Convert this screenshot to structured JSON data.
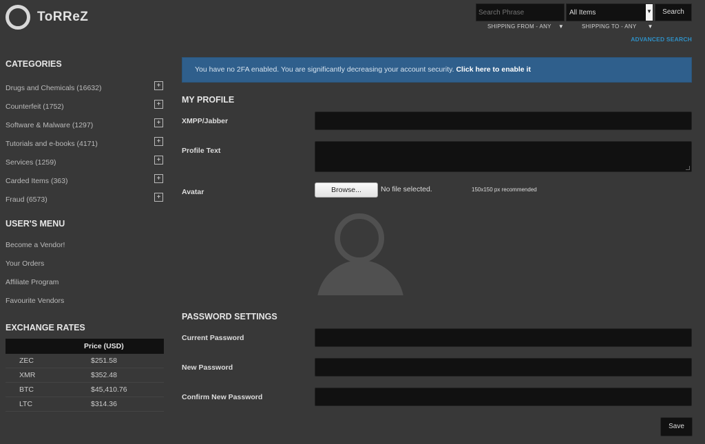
{
  "brand": {
    "name": "ToRReZ"
  },
  "search": {
    "placeholder": "Search Phrase",
    "category_selected": "All Items",
    "button_label": "Search",
    "shipping_from": "SHIPPING FROM - ANY",
    "shipping_to": "SHIPPING TO - ANY",
    "advanced_label": "ADVANCED SEARCH"
  },
  "sidebar": {
    "categories_heading": "CATEGORIES",
    "categories": [
      {
        "label": "Drugs and Chemicals (16632)"
      },
      {
        "label": "Counterfeit (1752)"
      },
      {
        "label": "Software & Malware (1297)"
      },
      {
        "label": "Tutorials and e-books (4171)"
      },
      {
        "label": "Services (1259)"
      },
      {
        "label": "Carded Items (363)"
      },
      {
        "label": "Fraud (6573)"
      }
    ],
    "expand_symbol": "+",
    "user_menu_heading": "USER'S MENU",
    "user_menu": [
      {
        "label": "Become a Vendor!"
      },
      {
        "label": "Your Orders"
      },
      {
        "label": "Affiliate Program"
      },
      {
        "label": "Favourite Vendors"
      }
    ],
    "exchange_heading": "EXCHANGE RATES",
    "exchange_column": "Price (USD)",
    "rates": [
      {
        "symbol": "ZEC",
        "price": "$251.58"
      },
      {
        "symbol": "XMR",
        "price": "$352.48"
      },
      {
        "symbol": "BTC",
        "price": "$45,410.76"
      },
      {
        "symbol": "LTC",
        "price": "$314.36"
      }
    ]
  },
  "alert": {
    "text": "You have no 2FA enabled. You are significantly decreasing your account security.",
    "link": "Click here to enable it",
    "color": "#2f5f8c"
  },
  "profile": {
    "heading": "MY PROFILE",
    "xmpp_label": "XMPP/Jabber",
    "profile_text_label": "Profile Text",
    "avatar_label": "Avatar",
    "browse_label": "Browse...",
    "no_file_text": "No file selected.",
    "avatar_hint": "150x150 px recommended"
  },
  "password": {
    "heading": "PASSWORD SETTINGS",
    "current_label": "Current Password",
    "new_label": "New Password",
    "confirm_label": "Confirm New Password",
    "save_label": "Save"
  },
  "colors": {
    "background": "#383838",
    "input": "#111111",
    "link": "#2f8fc4"
  }
}
